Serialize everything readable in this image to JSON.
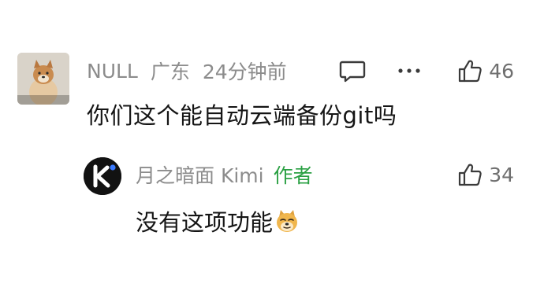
{
  "comment": {
    "username": "NULL",
    "location": "广东",
    "time": "24分钟前",
    "like_count": "46",
    "text": "你们这个能自动云端备份git吗",
    "avatar_caption": "这是一个园长"
  },
  "reply": {
    "username": "月之暗面 Kimi",
    "author_tag": "作者",
    "like_count": "34",
    "text": "没有这项功能"
  },
  "icons": {
    "comment": "comment-bubble-icon",
    "more": "more-dots-icon",
    "like": "thumbs-up-icon",
    "emoji": "doge-emoji-icon"
  },
  "colors": {
    "meta_gray": "#8c8c8c",
    "author_green": "#2aa043",
    "text": "#151515"
  }
}
